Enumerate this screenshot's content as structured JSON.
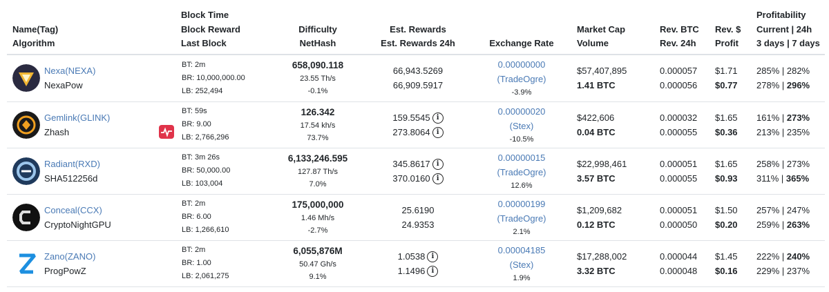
{
  "headers": {
    "name": [
      "Name(Tag)",
      "Algorithm"
    ],
    "block": [
      "Block Time",
      "Block Reward",
      "Last Block"
    ],
    "difficulty": [
      "Difficulty",
      "NetHash"
    ],
    "rewards": [
      "Est. Rewards",
      "Est. Rewards 24h"
    ],
    "exchange": "Exchange Rate",
    "market": [
      "Market Cap",
      "Volume"
    ],
    "revbtc": [
      "Rev. BTC",
      "Rev. 24h"
    ],
    "revusd": [
      "Rev. $",
      "Profit"
    ],
    "profit": [
      "Profitability",
      "Current | 24h",
      "3 days | 7 days"
    ]
  },
  "rows": [
    {
      "name": "Nexa(NEXA)",
      "algo": "NexaPow",
      "logo": "nexa-logo",
      "logo_bg": "#2a2a40",
      "logo_fg": "#f2b632",
      "bt": "BT: 2m",
      "br": "BR: 10,000,000.00",
      "lb": "LB: 252,494",
      "flag": false,
      "difficulty": "658,090.118",
      "nethash": "23.55 Th/s",
      "diff_change": "-0.1%",
      "reward": "66,943.5269",
      "reward24": "66,909.5917",
      "reward_info": false,
      "rate": "0.00000000",
      "exchange": "(TradeOgre)",
      "rate_change": "-3.9%",
      "marketcap": "$57,407,895",
      "volume": "1.41 BTC",
      "rev_btc": "0.000057",
      "rev_24h": "0.000056",
      "rev_usd": "$1.71",
      "profit_usd": "$0.77",
      "prof_current": "285%",
      "prof_24h": "282%",
      "prof_24h_bold": false,
      "prof_3d": "278%",
      "prof_7d": "296%",
      "prof_7d_bold": true
    },
    {
      "name": "Gemlink(GLINK)",
      "algo": "Zhash",
      "logo": "gemlink-logo",
      "logo_bg": "#1a1a1a",
      "logo_fg": "#f0a020",
      "bt": "BT: 59s",
      "br": "BR: 9.00",
      "lb": "LB: 2,766,296",
      "flag": true,
      "difficulty": "126.342",
      "nethash": "17.54 kh/s",
      "diff_change": "73.7%",
      "reward": "159.5545",
      "reward24": "273.8064",
      "reward_info": true,
      "rate": "0.00000020",
      "exchange": "(Stex)",
      "rate_change": "-10.5%",
      "marketcap": "$422,606",
      "volume": "0.04 BTC",
      "rev_btc": "0.000032",
      "rev_24h": "0.000055",
      "rev_usd": "$1.65",
      "profit_usd": "$0.36",
      "prof_current": "161%",
      "prof_24h": "273%",
      "prof_24h_bold": true,
      "prof_3d": "213%",
      "prof_7d": "235%",
      "prof_7d_bold": false
    },
    {
      "name": "Radiant(RXD)",
      "algo": "SHA512256d",
      "logo": "radiant-logo",
      "logo_bg": "#1f3a5c",
      "logo_fg": "#9cc6ec",
      "bt": "BT: 3m 26s",
      "br": "BR: 50,000.00",
      "lb": "LB: 103,004",
      "flag": false,
      "difficulty": "6,133,246.595",
      "nethash": "127.87 Th/s",
      "diff_change": "7.0%",
      "reward": "345.8617",
      "reward24": "370.0160",
      "reward_info": true,
      "rate": "0.00000015",
      "exchange": "(TradeOgre)",
      "rate_change": "12.6%",
      "marketcap": "$22,998,461",
      "volume": "3.57 BTC",
      "rev_btc": "0.000051",
      "rev_24h": "0.000055",
      "rev_usd": "$1.65",
      "profit_usd": "$0.93",
      "prof_current": "258%",
      "prof_24h": "273%",
      "prof_24h_bold": false,
      "prof_3d": "311%",
      "prof_7d": "365%",
      "prof_7d_bold": true
    },
    {
      "name": "Conceal(CCX)",
      "algo": "CryptoNightGPU",
      "logo": "conceal-logo",
      "logo_bg": "#111111",
      "logo_fg": "#dddddd",
      "bt": "BT: 2m",
      "br": "BR: 6.00",
      "lb": "LB: 1,266,610",
      "flag": false,
      "difficulty": "175,000,000",
      "nethash": "1.46 Mh/s",
      "diff_change": "-2.7%",
      "reward": "25.6190",
      "reward24": "24.9353",
      "reward_info": false,
      "rate": "0.00000199",
      "exchange": "(TradeOgre)",
      "rate_change": "2.1%",
      "marketcap": "$1,209,682",
      "volume": "0.12 BTC",
      "rev_btc": "0.000051",
      "rev_24h": "0.000050",
      "rev_usd": "$1.50",
      "profit_usd": "$0.20",
      "prof_current": "257%",
      "prof_24h": "247%",
      "prof_24h_bold": false,
      "prof_3d": "259%",
      "prof_7d": "263%",
      "prof_7d_bold": true
    },
    {
      "name": "Zano(ZANO)",
      "algo": "ProgPowZ",
      "logo": "zano-logo",
      "logo_bg": "#ffffff",
      "logo_fg": "#1d8fe0",
      "bt": "BT: 2m",
      "br": "BR: 1.00",
      "lb": "LB: 2,061,275",
      "flag": false,
      "difficulty": "6,055,876M",
      "nethash": "50.47 Gh/s",
      "diff_change": "9.1%",
      "reward": "1.0538",
      "reward24": "1.1496",
      "reward_info": true,
      "rate": "0.00004185",
      "exchange": "(Stex)",
      "rate_change": "1.9%",
      "marketcap": "$17,288,002",
      "volume": "3.32 BTC",
      "rev_btc": "0.000044",
      "rev_24h": "0.000048",
      "rev_usd": "$1.45",
      "profit_usd": "$0.16",
      "prof_current": "222%",
      "prof_24h": "240%",
      "prof_24h_bold": true,
      "prof_3d": "229%",
      "prof_7d": "237%",
      "prof_7d_bold": false
    }
  ],
  "icons": {
    "info": "info-icon",
    "flag": "pulse-alert-icon"
  }
}
